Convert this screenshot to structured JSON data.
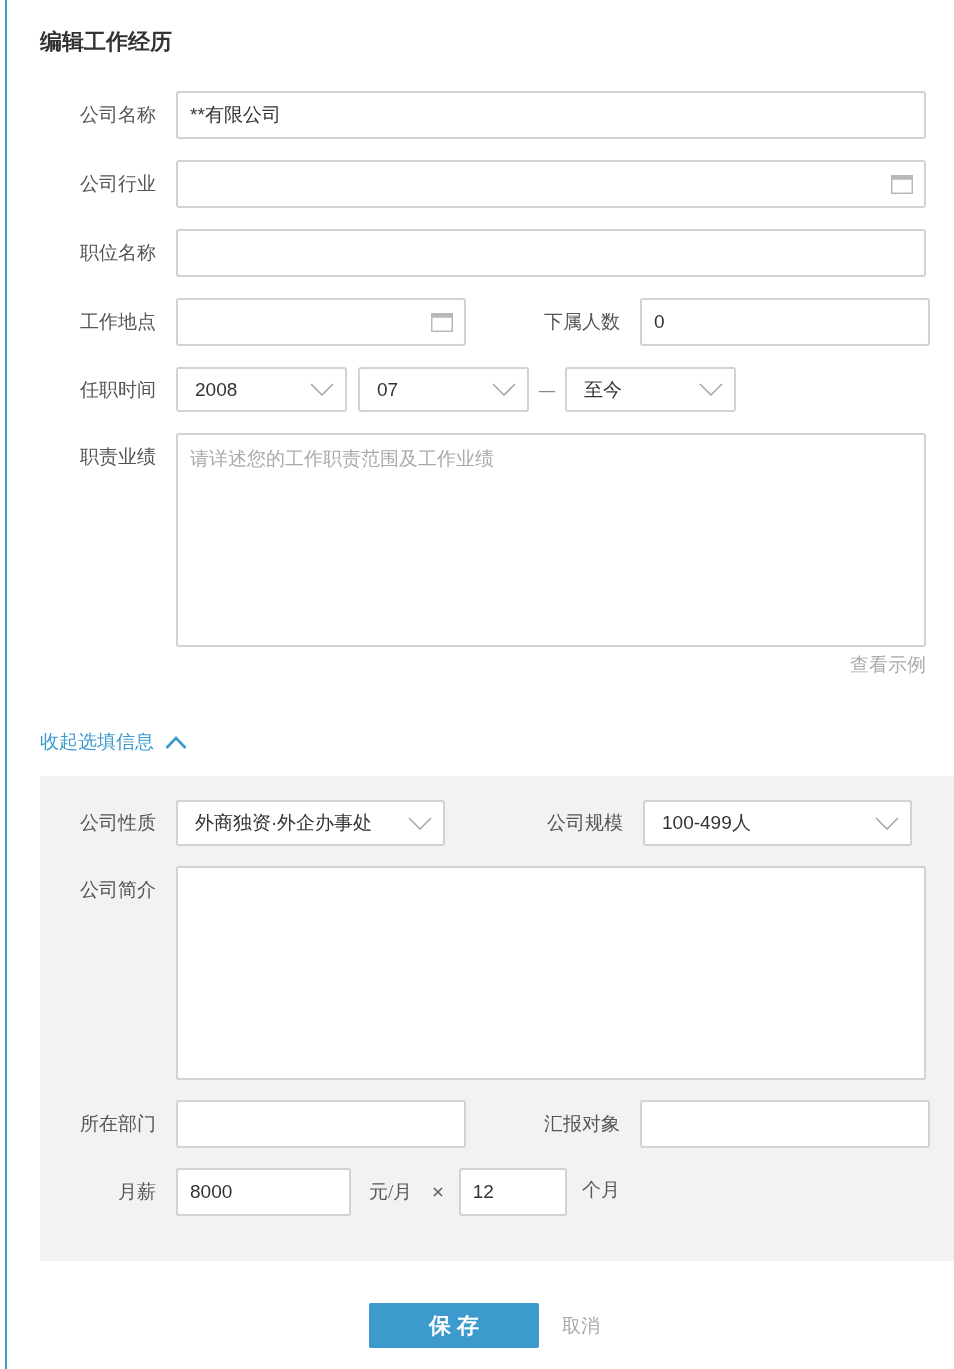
{
  "title": "编辑工作经历",
  "rows": [
    {
      "kind": "input",
      "label": "公司名称",
      "value": "**有限公司"
    },
    {
      "kind": "picker",
      "label": "公司行业"
    },
    {
      "kind": "input",
      "label": "职位名称"
    },
    {
      "kind": "pair",
      "fields": [
        {
          "kind": "picker",
          "label": "工作地点"
        },
        {
          "kind": "input",
          "label": "下属人数",
          "value": "0"
        }
      ]
    },
    {
      "kind": "period",
      "label": "任职时间",
      "start": [
        "2008",
        "07"
      ],
      "separator": "—",
      "end": "至今"
    },
    {
      "kind": "textarea",
      "label": "职责业绩",
      "placeholder": "请详述您的工作职责范围及工作业绩",
      "link": "查看示例"
    }
  ],
  "optional": {
    "toggle": "收起选填信息",
    "expanded": true,
    "rows": [
      {
        "kind": "pair",
        "fields": [
          {
            "kind": "select",
            "label": "公司性质",
            "value": "外商独资·外企办事处"
          },
          {
            "kind": "select",
            "label": "公司规模",
            "value": "100-499人"
          }
        ]
      },
      {
        "kind": "textarea",
        "label": "公司简介"
      },
      {
        "kind": "pair",
        "fields": [
          {
            "kind": "input",
            "label": "所在部门"
          },
          {
            "kind": "input",
            "label": "汇报对象"
          }
        ]
      },
      {
        "kind": "salary",
        "label": "月薪",
        "value": "8000",
        "unit": "元/月",
        "times": "×",
        "months": "12",
        "months_unit": "个月"
      }
    ]
  },
  "buttons": [
    {
      "kind": "primary",
      "label": "保 存"
    },
    {
      "kind": "link",
      "label": "取消"
    }
  ]
}
